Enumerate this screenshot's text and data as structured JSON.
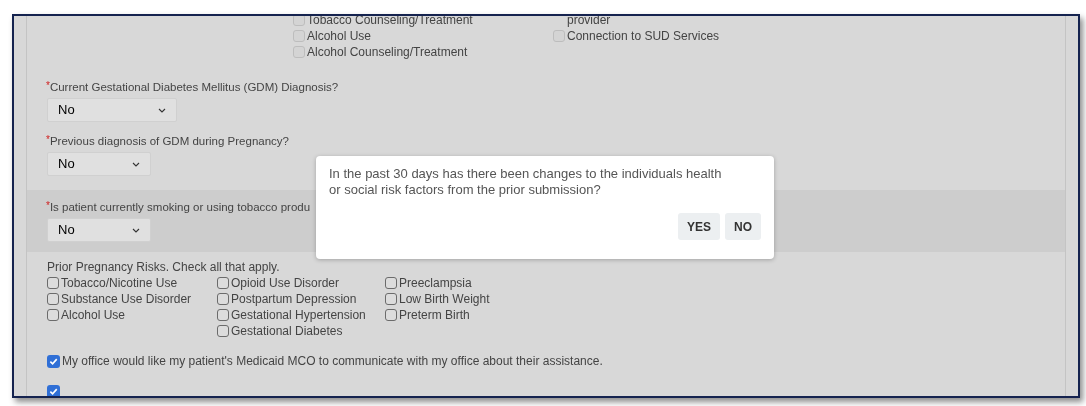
{
  "top_checkboxes": {
    "columns": [
      [
        {
          "label": "Tobacco Counseling/Treatment",
          "checked": false
        },
        {
          "label": "Alcohol Use",
          "checked": false
        },
        {
          "label": "Alcohol Counseling/Treatment",
          "checked": false
        }
      ],
      [
        {
          "label": "provider"
        },
        {
          "label": "Connection to SUD Services",
          "checked": false
        }
      ]
    ]
  },
  "questions": [
    {
      "label": "Current Gestational Diabetes Mellitus (GDM) Diagnosis?",
      "required_mark": "*",
      "value": "No",
      "highlighted": false
    },
    {
      "label": "Previous diagnosis of GDM during Pregnancy?",
      "required_mark": "*",
      "value": "No",
      "highlighted": false
    },
    {
      "label": "Is patient currently smoking or using tobacco produ",
      "required_mark": "*",
      "value": "No",
      "highlighted": true
    }
  ],
  "prior_risks": {
    "label": "Prior Pregnancy Risks.  Check all that apply.",
    "columns": [
      [
        {
          "label": "Tobacco/Nicotine Use",
          "checked": false
        },
        {
          "label": "Substance Use Disorder",
          "checked": false
        },
        {
          "label": "Alcohol Use",
          "checked": false
        }
      ],
      [
        {
          "label": "Opioid Use Disorder",
          "checked": false
        },
        {
          "label": "Postpartum Depression",
          "checked": false
        },
        {
          "label": "Gestational Hypertension",
          "checked": false
        },
        {
          "label": "Gestational Diabetes",
          "checked": false
        }
      ],
      [
        {
          "label": "Preeclampsia",
          "checked": false
        },
        {
          "label": "Low Birth Weight",
          "checked": false
        },
        {
          "label": "Preterm Birth",
          "checked": false
        }
      ]
    ]
  },
  "consents": [
    {
      "label": "My office would like my patient's Medicaid MCO to communicate with my office about their assistance.",
      "checked": true
    },
    {
      "checked": true
    }
  ],
  "dialog": {
    "message": "In the past 30 days has there been changes to the individuals health or social risk factors from the prior submission?",
    "buttons": [
      "YES",
      "NO"
    ]
  }
}
